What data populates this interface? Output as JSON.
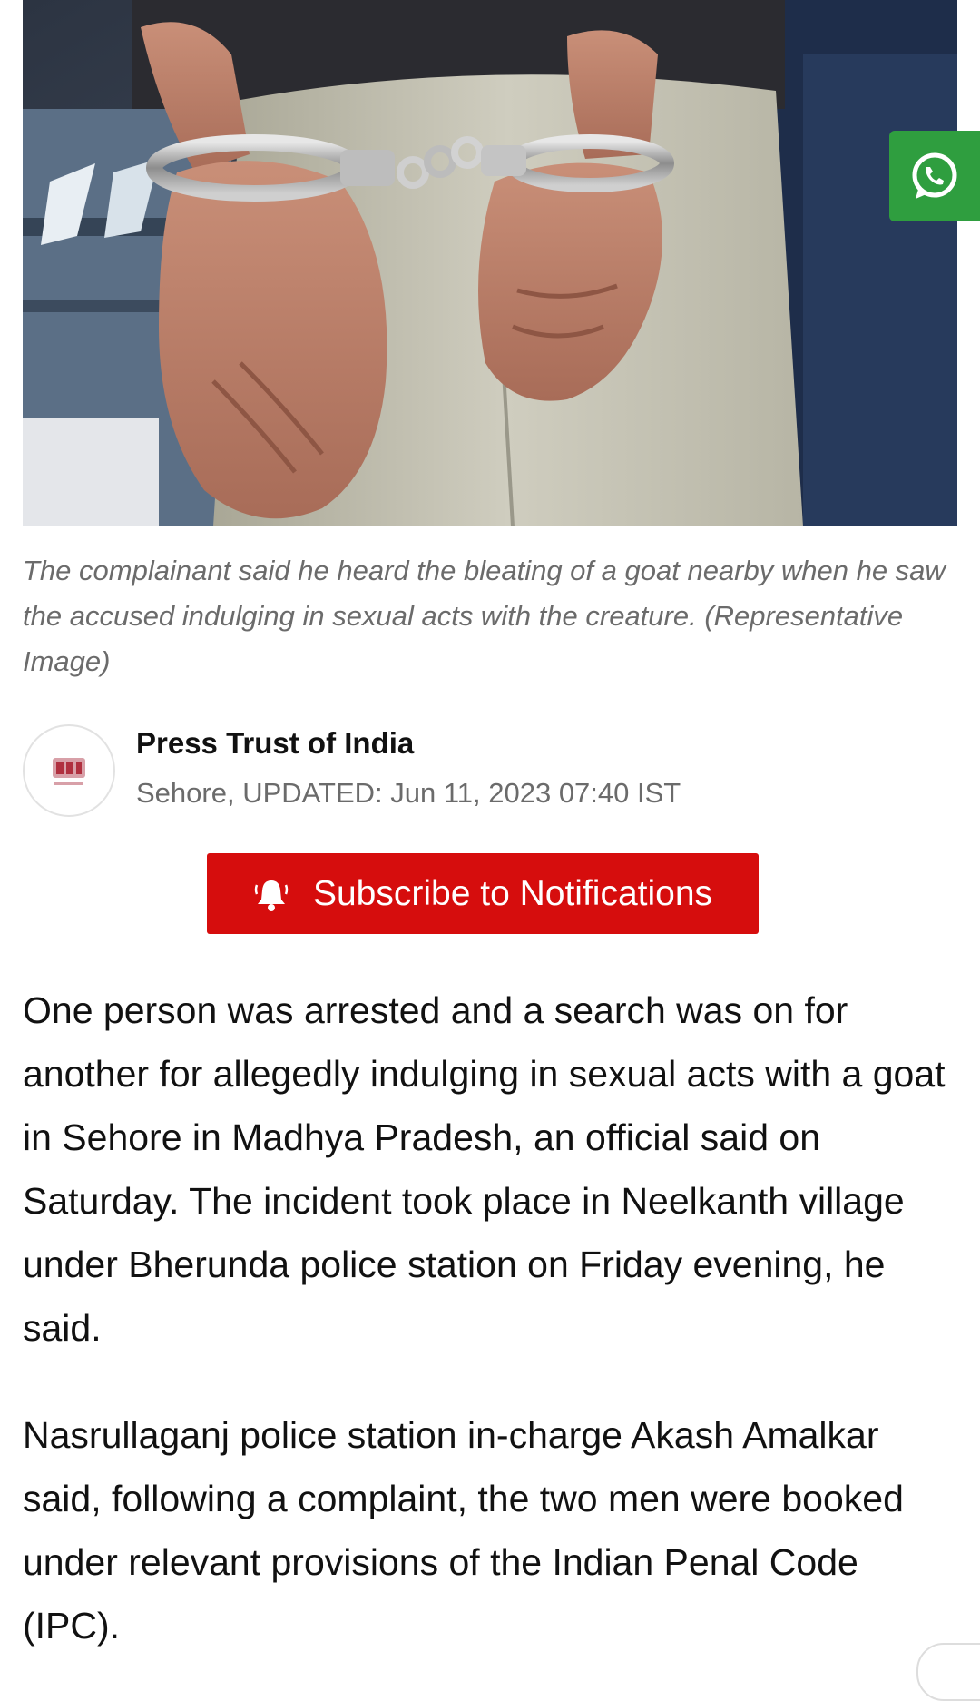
{
  "hero_image": {
    "alt": "Representative Image"
  },
  "share": {
    "icon": "whatsapp-icon",
    "color": "#2f9e3f"
  },
  "caption": "The complainant said he heard the bleating of a goat nearby when he saw the accused indulging in sexual acts with the creature. (Representative Image)",
  "byline": {
    "avatar_icon": "pti-logo",
    "author": "Press Trust of India",
    "meta": "Sehore, UPDATED: Jun 11, 2023 07:40 IST"
  },
  "subscribe": {
    "label": "Subscribe to Notifications",
    "icon": "bell-icon",
    "color": "#d60d0d"
  },
  "article": {
    "paragraphs": [
      "One person was arrested and a search was on for another for allegedly indulging in sexual acts with a goat in Sehore in Madhya Pradesh, an official said on Saturday. The incident took place in Neelkanth village under Bherunda police station on Friday evening, he said.",
      "Nasrullaganj police station in-charge Akash Amalkar said, following a complaint, the two men were booked under relevant provisions of the Indian Penal Code (IPC)."
    ]
  }
}
